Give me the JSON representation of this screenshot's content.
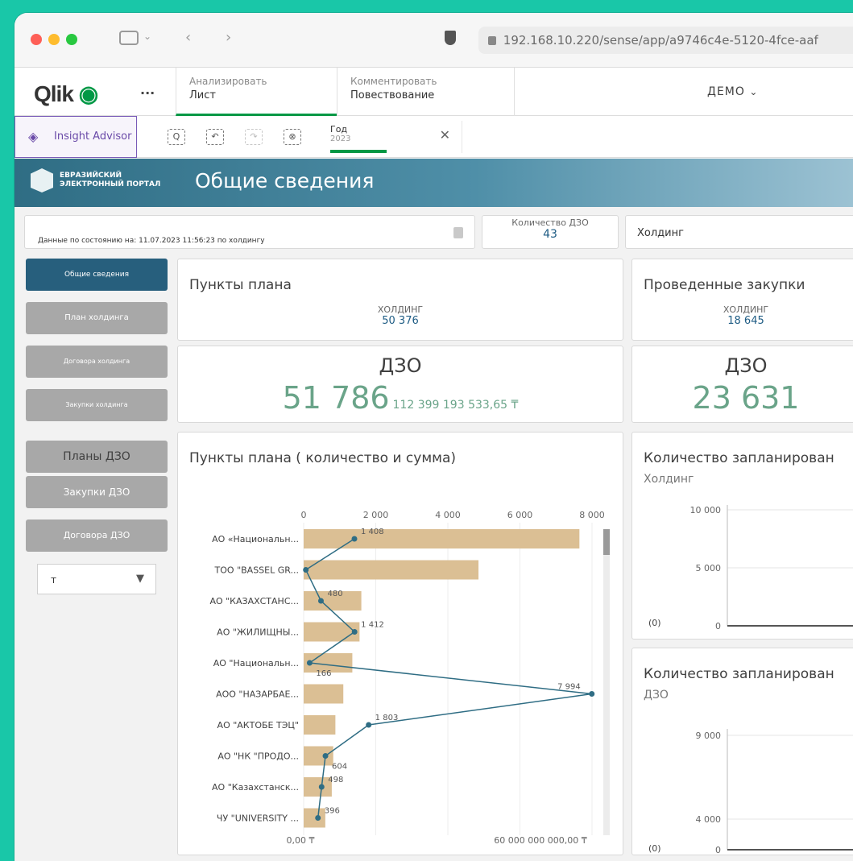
{
  "browser": {
    "url": "192.168.10.220/sense/app/a9746c4e-5120-4fce-aaf",
    "colors": {
      "red": "#fe5f57",
      "yellow": "#febc2e",
      "green": "#28c840"
    }
  },
  "qlik": {
    "logo": "Qlik",
    "more": "...",
    "tabs": [
      {
        "small": "Анализировать",
        "label": "Лист"
      },
      {
        "small": "Комментировать",
        "label": "Повествование"
      }
    ],
    "app_name": "ДЕМО",
    "insight_advisor": "Insight Advisor",
    "selection": {
      "field": "Год",
      "value": "2023"
    }
  },
  "banner": {
    "logo_text": "ЕВРАЗИЙСКИЙ\nЭЛЕКТРОННЫЙ ПОРТАЛ",
    "title": "Общие сведения"
  },
  "info_text": "Данные по состоянию на: 11.07.2023 11:56:23 по холдингу",
  "kpi_dzo_count": {
    "label": "Количество ДЗО",
    "value": "43"
  },
  "holding_filter": "Холдинг",
  "nav": [
    {
      "label": "Общие сведения",
      "active": true,
      "size": "small"
    },
    {
      "label": "План холдинга",
      "active": false,
      "size": "small"
    },
    {
      "label": "Договора холдинга",
      "active": false,
      "size": "tiny"
    },
    {
      "label": "Закупки холдинга",
      "active": false,
      "size": "tiny"
    },
    {
      "label": "Планы ДЗО",
      "active": false,
      "size": "big"
    },
    {
      "label": "Закупки ДЗО",
      "active": false,
      "size": "normal"
    },
    {
      "label": "Договора ДЗО",
      "active": false,
      "size": "small"
    }
  ],
  "currency_select": "т",
  "plan_points": {
    "title": "Пункты плана",
    "label": "ХОЛДИНГ",
    "value": "50 376"
  },
  "purchases": {
    "title": "Проведенные закупки",
    "label": "ХОЛДИНГ",
    "value": "18 645"
  },
  "plan_dzo": {
    "label": "ДЗО",
    "value": "51 786",
    "sum": "112 399 193 533,65 ₸"
  },
  "purch_dzo": {
    "label": "ДЗО",
    "value": "23 631"
  },
  "chart1": {
    "title": "Пункты плана ( количество и сумма)",
    "top_axis_ticks": [
      "0",
      "2 000",
      "4 000",
      "6 000",
      "8 000"
    ],
    "bottom_axis_ticks": [
      "0,00 ₸",
      "60 000 000 000,00 ₸"
    ]
  },
  "chart2": {
    "title": "Количество запланирован",
    "subtitle": "Холдинг",
    "y_ticks": [
      "10 000",
      "5 000",
      "0"
    ],
    "null_label": "(0)"
  },
  "chart3": {
    "title": "Количество запланирован",
    "subtitle": "ДЗО",
    "y_ticks": [
      "9 000",
      "4 000",
      "0"
    ],
    "null_label": "(0)"
  },
  "chart_data": [
    {
      "type": "bar",
      "title": "Пункты плана ( количество и сумма)",
      "categories": [
        "АО «Национальн...",
        "ТОО \"BASSEL GR...",
        "АО \"КАЗАХСТАНС...",
        "АО \"ЖИЛИЩНЫ...",
        "АО \"Национальн...",
        "АОО \"НАЗАРБАЕ...",
        "АО \"АКТОБЕ ТЭЦ\"",
        "АО \"НК \"ПРОДО...",
        "АО \"Казахстанск...",
        "ЧУ \"UNIVERSITY ..."
      ],
      "series": [
        {
          "type": "bar",
          "values": [
            7650,
            4850,
            1600,
            1550,
            1350,
            1100,
            880,
            820,
            780,
            600
          ]
        },
        {
          "type": "line",
          "values": [
            1408,
            60,
            480,
            1412,
            166,
            7994,
            1803,
            604,
            498,
            396
          ]
        }
      ],
      "point_labels": [
        "1 408",
        "",
        "480",
        "1 412",
        "166",
        "7 994",
        "1 803",
        "604",
        "498",
        "396"
      ],
      "xlim": [
        0,
        8000
      ]
    }
  ]
}
